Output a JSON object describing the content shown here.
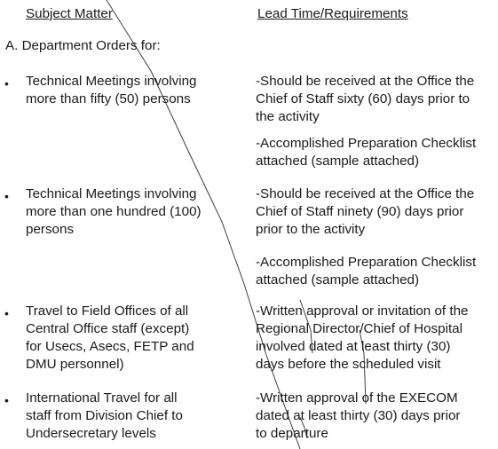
{
  "headers": {
    "subject": "Subject Matter",
    "lead": "Lead Time/Requirements"
  },
  "section_a": "A. Department Orders for:",
  "bullet_glyph": "•",
  "items": [
    {
      "subject_lines": [
        "Technical Meetings involving",
        "more than fifty (50) persons"
      ],
      "requirements": [
        {
          "lines": [
            "-Should be received at the Office the",
            "Chief of Staff sixty (60) days prior to",
            "the activity"
          ]
        },
        {
          "lines": [
            "-Accomplished Preparation Checklist",
            "attached (sample attached)"
          ]
        }
      ]
    },
    {
      "subject_lines": [
        "Technical Meetings involving",
        "more than one hundred (100)",
        "persons"
      ],
      "requirements": [
        {
          "lines": [
            "-Should be received at the Office the",
            "Chief of Staff ninety (90) days prior",
            "prior to the activity"
          ]
        },
        {
          "lines": [
            "-Accomplished Preparation Checklist",
            "attached (sample attached)"
          ]
        }
      ]
    },
    {
      "subject_lines": [
        "Travel to Field Offices of all",
        "Central Office staff (except)",
        "for Usecs, Asecs, FETP and",
        "DMU personnel)"
      ],
      "requirements": [
        {
          "lines": [
            "-Written approval or invitation of the",
            "Regional Director/Chief of Hospital",
            "involved dated at least thirty (30)",
            "days before the scheduled visit"
          ]
        }
      ]
    },
    {
      "subject_lines": [
        "International Travel for all",
        "staff from Division Chief to",
        "Undersecretary levels"
      ],
      "requirements": [
        {
          "lines": [
            "-Written approval of the EXECOM",
            "dated at least thirty (30) days prior",
            "to departure"
          ]
        }
      ]
    }
  ]
}
